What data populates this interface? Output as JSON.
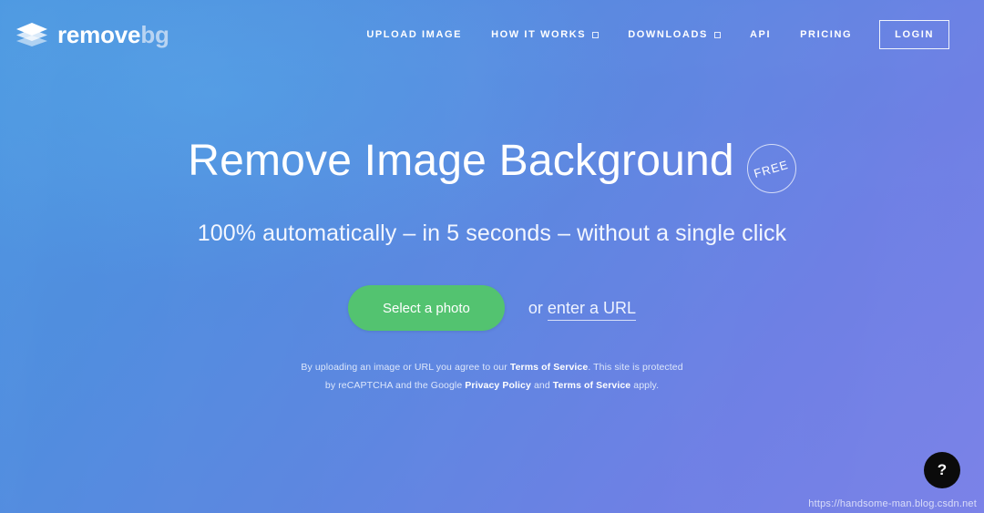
{
  "brand": {
    "name_primary": "remove",
    "name_secondary": "bg",
    "logo_icon": "layers-stack-icon"
  },
  "nav": {
    "items": [
      {
        "label": "Upload Image",
        "has_dropdown": false
      },
      {
        "label": "How it works",
        "has_dropdown": true
      },
      {
        "label": "Downloads",
        "has_dropdown": true
      },
      {
        "label": "API",
        "has_dropdown": false
      },
      {
        "label": "Pricing",
        "has_dropdown": false
      }
    ],
    "login_label": "Login"
  },
  "hero": {
    "headline": "Remove Image Background",
    "badge": "FREE",
    "subheadline": "100% automatically – in 5 seconds – without a single click",
    "cta_button": "Select a photo",
    "or_prefix": "or ",
    "url_link": "enter a URL",
    "legal_line1_before": "By uploading an image or URL you agree to our ",
    "legal_line1_link": "Terms of Service",
    "legal_line1_after": ". This site is protected",
    "legal_line2_before": "by reCAPTCHA and the Google ",
    "legal_line2_link1": "Privacy Policy",
    "legal_line2_middle": " and ",
    "legal_line2_link2": "Terms of Service",
    "legal_line2_after": " apply."
  },
  "help": {
    "label": "?"
  },
  "watermark": {
    "url": "https://handsome-man.blog.csdn.net"
  },
  "colors": {
    "accent_green": "#53c370",
    "gradient_start": "#4a98e1",
    "gradient_end": "#7e82e9",
    "text_white": "#ffffff",
    "logo_secondary": "#b9d4f2"
  }
}
